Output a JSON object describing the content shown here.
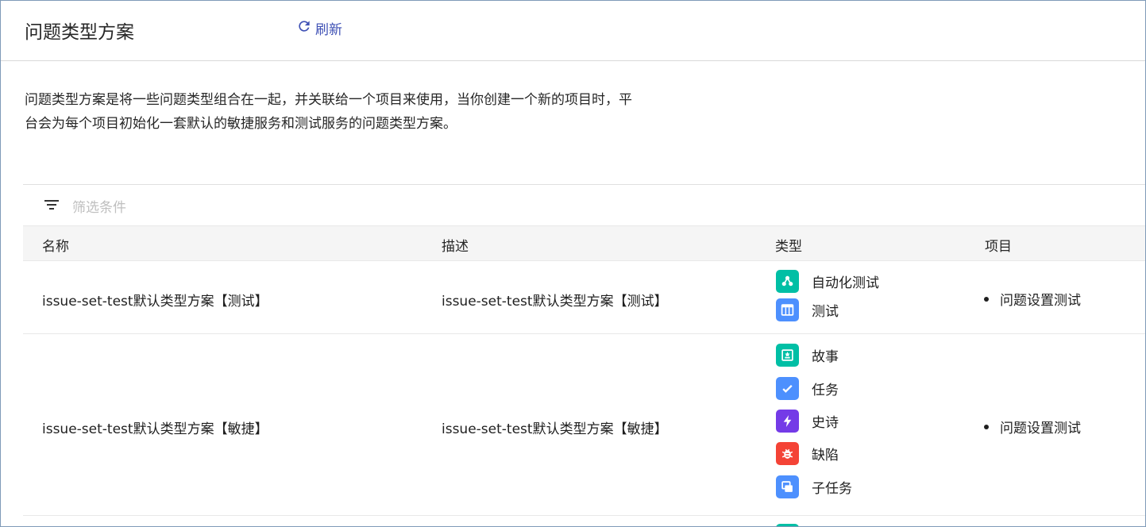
{
  "header": {
    "title": "问题类型方案",
    "refresh_label": "刷新"
  },
  "description": "问题类型方案是将一些问题类型组合在一起，并关联给一个项目来使用，当你创建一个新的项目时，平台会为每个项目初始化一套默认的敏捷服务和测试服务的问题类型方案。",
  "filter": {
    "placeholder": "筛选条件"
  },
  "table": {
    "columns": [
      "名称",
      "描述",
      "类型",
      "项目"
    ],
    "rows": [
      {
        "name": "issue-set-test默认类型方案【测试】",
        "description": "issue-set-test默认类型方案【测试】",
        "types": [
          {
            "label": "自动化测试",
            "icon": "auto-test-icon",
            "color": "#00bfa5"
          },
          {
            "label": "测试",
            "icon": "test-icon",
            "color": "#4d90fe"
          }
        ],
        "project": "问题设置测试"
      },
      {
        "name": "issue-set-test默认类型方案【敏捷】",
        "description": "issue-set-test默认类型方案【敏捷】",
        "types": [
          {
            "label": "故事",
            "icon": "story-icon",
            "color": "#00bfa5"
          },
          {
            "label": "任务",
            "icon": "task-icon",
            "color": "#4d90fe"
          },
          {
            "label": "史诗",
            "icon": "epic-icon",
            "color": "#743be7"
          },
          {
            "label": "缺陷",
            "icon": "bug-icon",
            "color": "#f44336"
          },
          {
            "label": "子任务",
            "icon": "subtask-icon",
            "color": "#4d90fe"
          }
        ],
        "project": "问题设置测试"
      }
    ]
  },
  "colors": {
    "accent": "#3f51b5",
    "header_bg": "#f5f5f5"
  }
}
